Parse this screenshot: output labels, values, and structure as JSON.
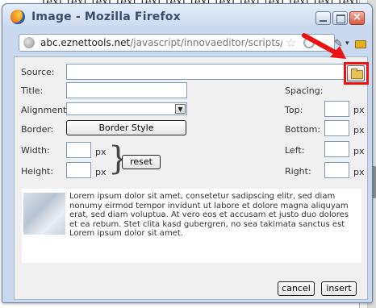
{
  "background": {
    "text": "text text text text text text text text text text text text text tex"
  },
  "window": {
    "title": "Image - Mozilla Firefox",
    "url_domain": "abc.eznettools.net",
    "url_path": "/javascript/innovaeditor/scripts/moz/image.h"
  },
  "form": {
    "source_label": "Source:",
    "source_value": "",
    "title_label": "Title:",
    "title_value": "",
    "alignment_label": "Alignment:",
    "alignment_value": "",
    "border_label": "Border:",
    "border_style_button": "Border Style",
    "width_label": "Width:",
    "height_label": "Height:",
    "width_value": "",
    "height_value": "",
    "px_unit": "px",
    "reset_button": "reset",
    "spacing_label": "Spacing:",
    "top_label": "Top:",
    "bottom_label": "Bottom:",
    "left_label": "Left:",
    "right_label": "Right:"
  },
  "preview": {
    "text": "Lorem ipsum dolor sit amet, consetetur sadipscing elitr, sed diam nonumy eirmod tempor invidunt ut labore et dolore magna aliquyam erat, sed diam voluptua. At vero eos et accusam et justo duo dolores et ea rebum. Stet clita kasd gubergren, no sea takimata sanctus est Lorem ipsum dolor sit amet."
  },
  "buttons": {
    "cancel": "cancel",
    "insert": "insert"
  },
  "colors": {
    "highlight": "#e11111",
    "window_frame": "#c9daf0"
  },
  "icons": [
    "firefox-icon",
    "globe-icon",
    "star-icon",
    "folder-icon",
    "arrow-icon"
  ]
}
